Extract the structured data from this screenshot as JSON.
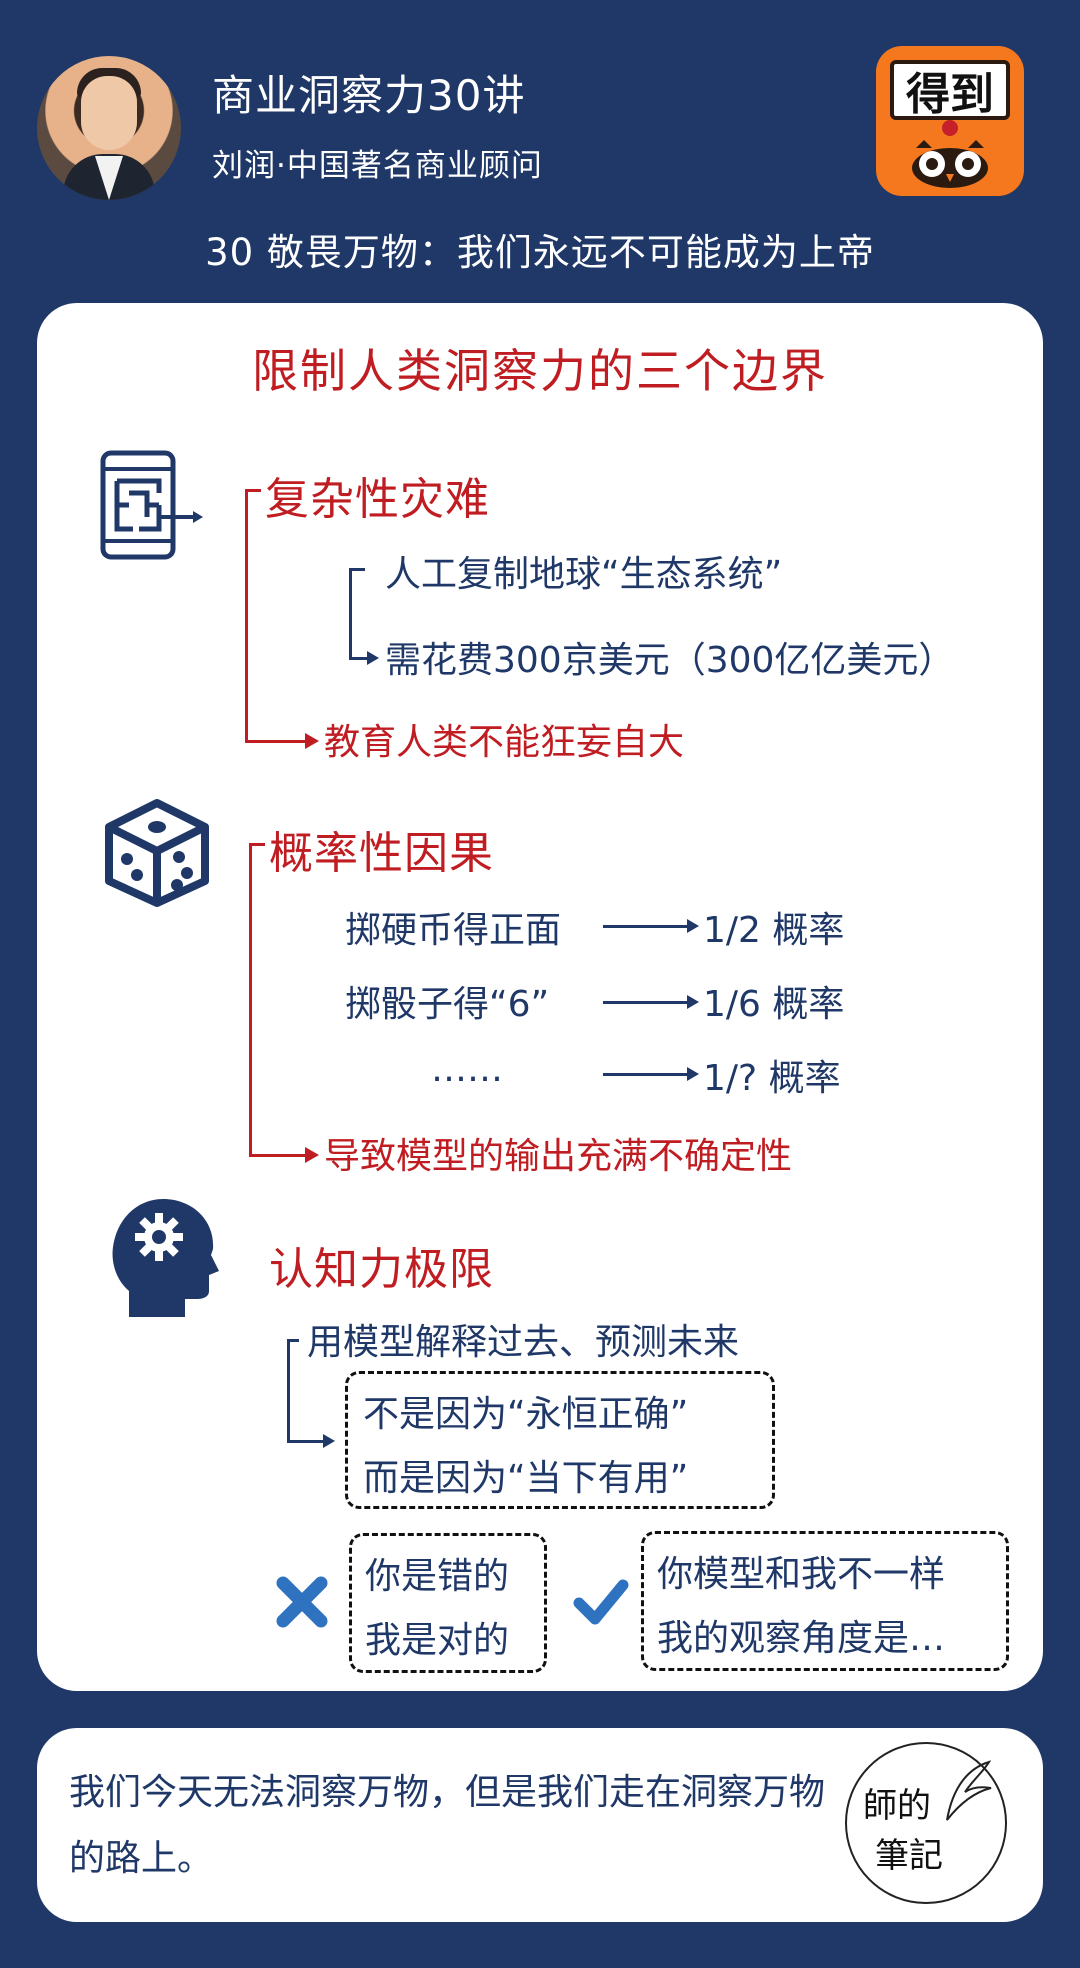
{
  "header": {
    "course_title": "商业洞察力30讲",
    "author_line": "刘润·中国著名商业顾问",
    "lesson_title": "30  敬畏万物：我们永远不可能成为上帝",
    "brand_text": "得到"
  },
  "main": {
    "title": "限制人类洞察力的三个边界",
    "section1": {
      "heading": "复杂性灾难",
      "item1": "人工复制地球“生态系统”",
      "item2": "需花费300京美元（300亿亿美元）",
      "conclusion": "教育人类不能狂妄自大"
    },
    "section2": {
      "heading": "概率性因果",
      "rows": [
        {
          "left": "掷硬币得正面",
          "right": "1/2 概率"
        },
        {
          "left": "掷骰子得“6”",
          "right": "1/6 概率"
        },
        {
          "left": "……",
          "right": "1/? 概率"
        }
      ],
      "conclusion": "导致模型的输出充满不确定性"
    },
    "section3": {
      "heading": "认知力极限",
      "line1": "用模型解释过去、预测未来",
      "box_line1": "不是因为“永恒正确”",
      "box_line2": "而是因为“当下有用”",
      "wrong_line1": "你是错的",
      "wrong_line2": "我是对的",
      "right_line1": "你模型和我不一样",
      "right_line2": "我的观察角度是…"
    }
  },
  "footer": {
    "text": "我们今天无法洞察万物，但是我们走在洞察万物的路上。",
    "seal_line1": "師的",
    "seal_line2": "筆記"
  },
  "colors": {
    "background": "#1f3868",
    "accent_red": "#c01d22",
    "text_navy": "#1f3868",
    "brand_orange": "#f5781e",
    "cross_blue": "#2f73c0"
  }
}
